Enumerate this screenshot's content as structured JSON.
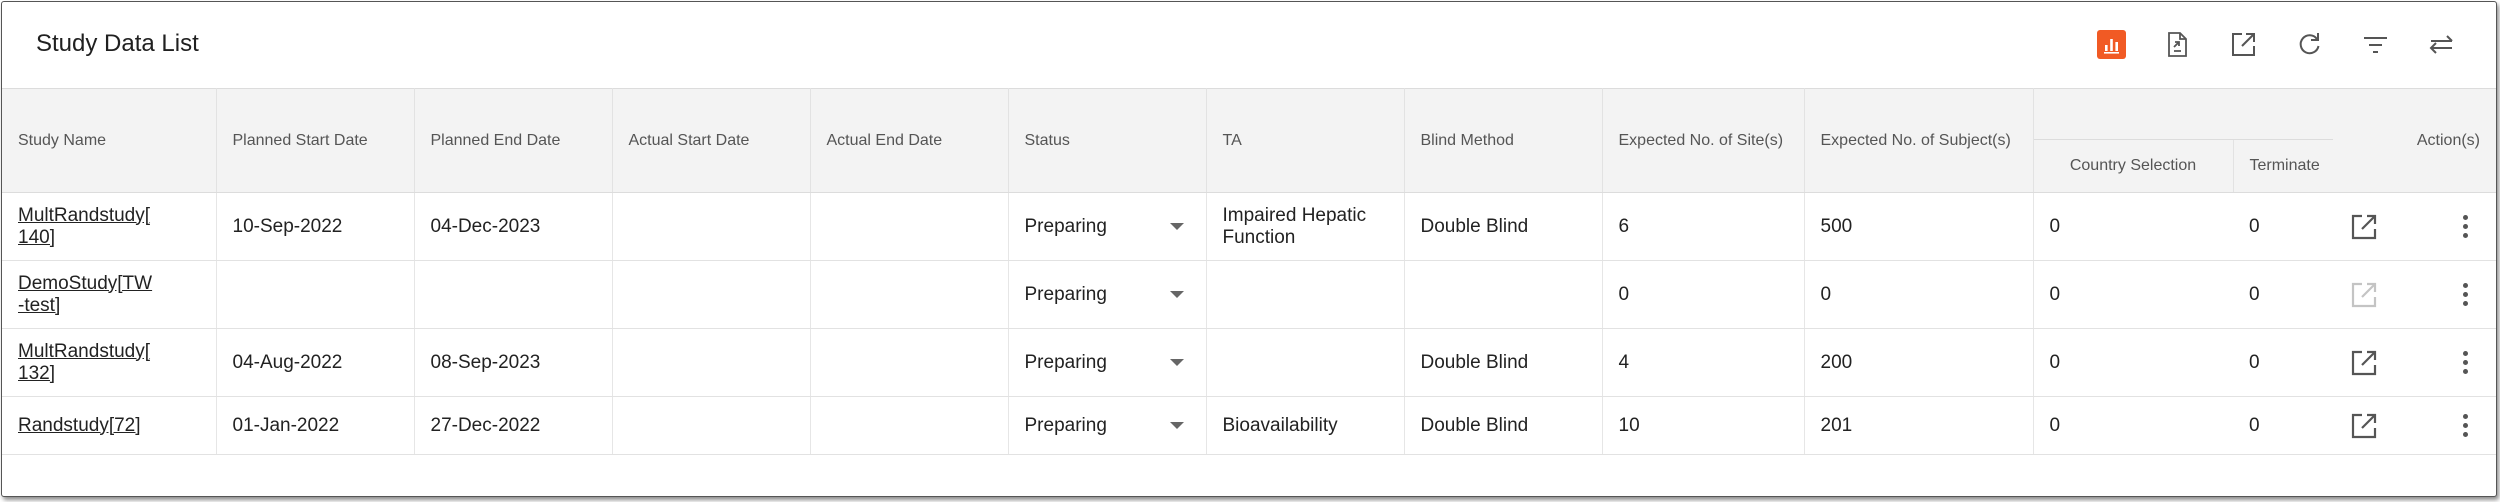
{
  "header": {
    "title": "Study Data List",
    "toolbar": [
      {
        "icon": "chart-icon",
        "active": true
      },
      {
        "icon": "export-file-icon"
      },
      {
        "icon": "open-external-icon"
      },
      {
        "icon": "refresh-icon"
      },
      {
        "icon": "filter-icon"
      },
      {
        "icon": "swap-icon"
      }
    ]
  },
  "colors": {
    "accent": "#f15a24",
    "header_bg": "#f3f3f3"
  },
  "table": {
    "columns": {
      "study_name": "Study Name",
      "planned_start": "Planned Start Date",
      "planned_end": "Planned End Date",
      "actual_start": "Actual Start Date",
      "actual_end": "Actual End Date",
      "status": "Status",
      "ta": "TA",
      "blind_method": "Blind Method",
      "expected_sites": "Expected No. of Site(s)",
      "expected_subjects": "Expected No. of Subject(s)",
      "country_selection": "Country Selection",
      "terminate": "Terminate",
      "actions": "Action(s)"
    },
    "rows": [
      {
        "study_name": "MultRandstudy[140]",
        "study_name_l1": "MultRandstudy[",
        "study_name_l2": "140]",
        "planned_start": "10-Sep-2022",
        "planned_end": "04-Dec-2023",
        "actual_start": "",
        "actual_end": "",
        "status": "Preparing",
        "ta_l1": "Impaired Hepatic",
        "ta_l2": "Function",
        "blind_method": "Double Blind",
        "expected_sites": "6",
        "expected_subjects": "500",
        "country_selection": "0",
        "terminate": "0",
        "open_enabled": true
      },
      {
        "study_name": "DemoStudy[TW-test]",
        "study_name_l1": "DemoStudy[TW",
        "study_name_l2": "-test]",
        "planned_start": "",
        "planned_end": "",
        "actual_start": "",
        "actual_end": "",
        "status": "Preparing",
        "ta_l1": "",
        "ta_l2": "",
        "blind_method": "",
        "expected_sites": "0",
        "expected_subjects": "0",
        "country_selection": "0",
        "terminate": "0",
        "open_enabled": false
      },
      {
        "study_name": "MultRandstudy[132]",
        "study_name_l1": "MultRandstudy[",
        "study_name_l2": "132]",
        "planned_start": "04-Aug-2022",
        "planned_end": "08-Sep-2023",
        "actual_start": "",
        "actual_end": "",
        "status": "Preparing",
        "ta_l1": "",
        "ta_l2": "",
        "blind_method": "Double Blind",
        "expected_sites": "4",
        "expected_subjects": "200",
        "country_selection": "0",
        "terminate": "0",
        "open_enabled": true
      },
      {
        "study_name": "Randstudy[72]",
        "study_name_l1": "Randstudy[72]",
        "study_name_l2": "",
        "planned_start": "01-Jan-2022",
        "planned_end": "27-Dec-2022",
        "actual_start": "",
        "actual_end": "",
        "status": "Preparing",
        "ta_l1": "Bioavailability",
        "ta_l2": "",
        "blind_method": "Double Blind",
        "expected_sites": "10",
        "expected_subjects": "201",
        "country_selection": "0",
        "terminate": "0",
        "open_enabled": true
      }
    ]
  }
}
